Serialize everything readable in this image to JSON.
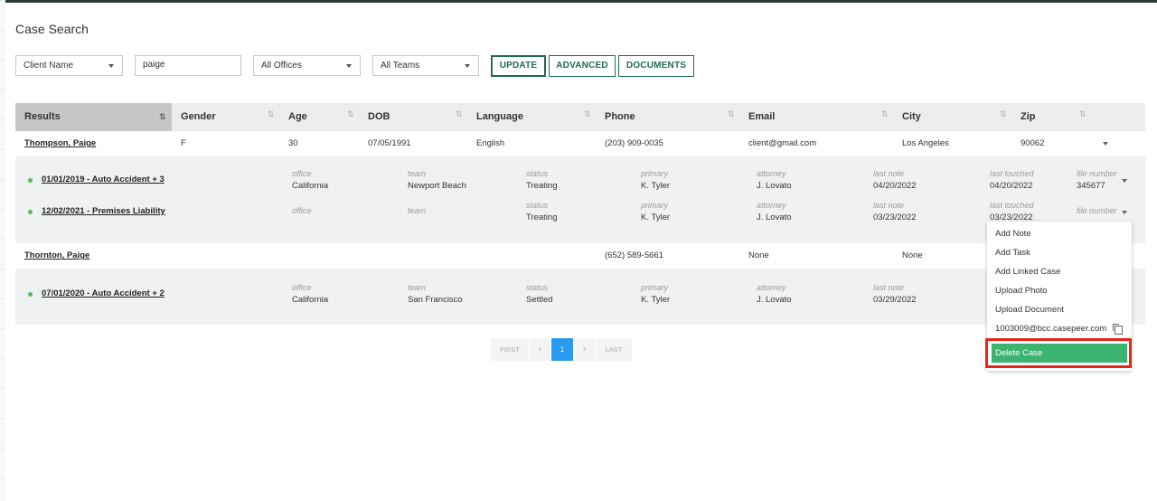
{
  "page": {
    "title": "Case Search"
  },
  "filters": {
    "search_by": "Client Name",
    "query": "paige",
    "office": "All Offices",
    "team": "All Teams",
    "update_label": "UPDATE",
    "advanced_label": "ADVANCED",
    "documents_label": "DOCUMENTS"
  },
  "table": {
    "headers": [
      "Results",
      "Gender",
      "Age",
      "DOB",
      "Language",
      "Phone",
      "Email",
      "City",
      "Zip"
    ],
    "sort_glyph": "⇅"
  },
  "clients": [
    {
      "name": "Thompson, Paige",
      "gender": "F",
      "age": "30",
      "dob": "07/05/1991",
      "language": "English",
      "phone": "(203) 909-0035",
      "email": "client@gmail.com",
      "city": "Los Angeles",
      "zip": "90062",
      "cases": [
        {
          "title": "01/01/2019 - Auto Accident + 3",
          "office": "California",
          "team": "Newport Beach",
          "status": "Treating",
          "primary": "K. Tyler",
          "attorney": "J. Lovato",
          "last_note": "04/20/2022",
          "last_touched": "04/20/2022",
          "file_number": "345677"
        },
        {
          "title": "12/02/2021 - Premises Liability",
          "office": "",
          "team": "",
          "status": "Treating",
          "primary": "K. Tyler",
          "attorney": "J. Lovato",
          "last_note": "03/23/2022",
          "last_touched": "03/23/2022",
          "file_number": ""
        }
      ]
    },
    {
      "name": "Thornton, Paige",
      "gender": "",
      "age": "",
      "dob": "",
      "language": "",
      "phone": "(652) 589-5661",
      "email": "None",
      "city": "None",
      "zip": "",
      "cases": [
        {
          "title": "07/01/2020 - Auto Accident + 2",
          "office": "California",
          "team": "San Francisco",
          "status": "Settled",
          "primary": "K. Tyler",
          "attorney": "J. Lovato",
          "last_note": "03/29/2022",
          "last_touched": "",
          "file_number": ""
        }
      ]
    }
  ],
  "case_labels": {
    "office": "office",
    "team": "team",
    "status": "status",
    "primary": "primary",
    "attorney": "attorney",
    "last_note": "last note",
    "last_touched": "last touched",
    "file_number": "file number"
  },
  "pagination": {
    "first": "FIRST",
    "prev": "‹",
    "current": "1",
    "next": "›",
    "last": "LAST"
  },
  "context_menu": {
    "items": [
      "Add Note",
      "Add Task",
      "Add Linked Case",
      "Upload Photo",
      "Upload Document",
      "1003009@bcc.casepeer.com"
    ],
    "delete": "Delete Case"
  },
  "colors": {
    "accent": "#1f6b53",
    "delete": "#3cb371",
    "highlight": "#e2261a",
    "page_active": "#2a9cf0"
  }
}
